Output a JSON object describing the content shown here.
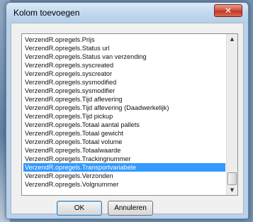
{
  "dialog": {
    "title": "Kolom toevoegen",
    "close_icon": "✕"
  },
  "list": {
    "items": [
      "VerzendR.opregels.Prijs",
      "VerzendR.opregels.Status url",
      "VerzendR.opregels.Status van verzending",
      "VerzendR.opregels.syscreated",
      "VerzendR.opregels.syscreator",
      "VerzendR.opregels.sysmodified",
      "VerzendR.opregels.sysmodifier",
      "VerzendR.opregels.Tijd aflevering",
      "VerzendR.opregels.Tijd aflevering (Daadwerkelijk)",
      "VerzendR.opregels.Tijd pickup",
      "VerzendR.opregels.Totaal aantal pallets",
      "VerzendR.opregels.Totaal gewicht",
      "VerzendR.opregels.Totaal volume",
      "VerzendR.opregels.Totaalwaarde",
      "VerzendR.opregels.Trackingnummer",
      "VerzendR.opregels.Transportvariabele",
      "VerzendR.opregels.Verzonden",
      "VerzendR.opregels.Volgnummer"
    ],
    "selected_index": 15
  },
  "scrollbar": {
    "up_icon": "▲",
    "down_icon": "▼"
  },
  "buttons": {
    "ok_label": "OK",
    "cancel_label": "Annuleren"
  }
}
